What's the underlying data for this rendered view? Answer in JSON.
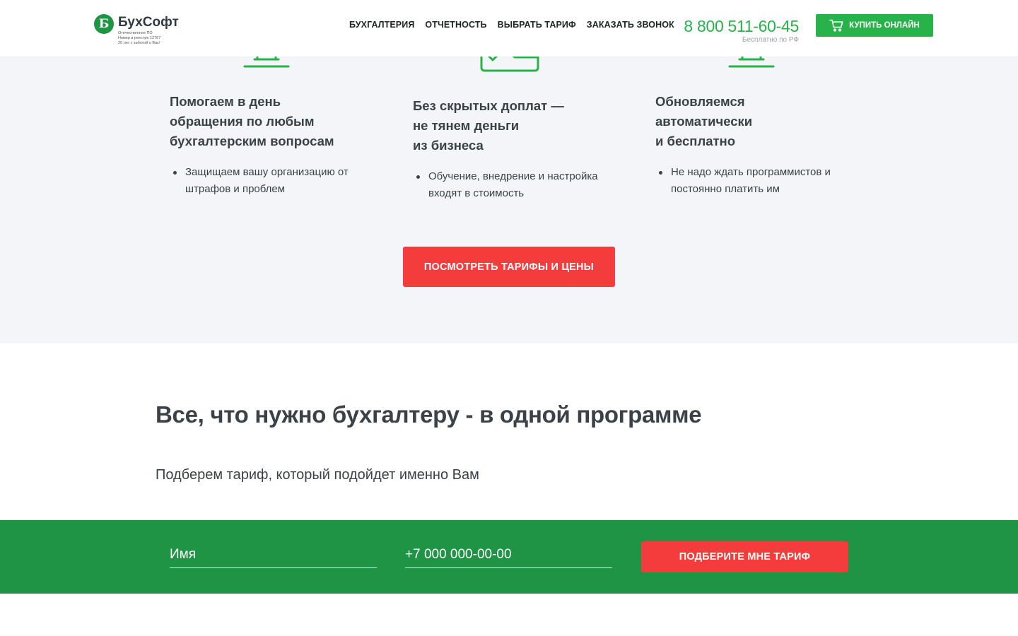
{
  "header": {
    "logo_letter": "Б",
    "logo_name": "БухСофт",
    "logo_sub": [
      "Отечественное ПО",
      "Номер в реестре 12767",
      "20 лет с заботой о Вас!"
    ],
    "nav": [
      "БУХГАЛТЕРИЯ",
      "ОТЧЕТНОСТЬ",
      "ВЫБРАТЬ ТАРИФ",
      "ЗАКАЗАТЬ ЗВОНОК"
    ],
    "phone": "8 800 511-60-45",
    "phone_note": "Бесплатно по РФ",
    "buy_label": "КУПИТЬ ОНЛАЙН",
    "buy_icon": "cart-icon"
  },
  "features": [
    {
      "icon": "support-icon",
      "title": "Помогаем в день\nобращения по любым\nбухгалтерским вопросам",
      "bullet": "Защищаем вашу организацию от штрафов и проблем"
    },
    {
      "icon": "wallet-icon",
      "title": "Без скрытых доплат —\nне тянем деньги\nиз бизнеса",
      "bullet": "Обучение, внедрение и настройка входят в стоимость"
    },
    {
      "icon": "update-icon",
      "title": "Обновляемся\nавтоматически\nи бесплатно",
      "bullet": "Не надо ждать программистов и постоянно платить им"
    }
  ],
  "cta_label": "ПОСМОТРЕТЬ ТАРИФЫ И ЦЕНЫ",
  "main": {
    "title": "Все, что нужно бухгалтеру - в одной программе",
    "subtitle": "Подберем тариф, который подойдет именно Вам"
  },
  "form": {
    "name_placeholder": "Имя",
    "phone_placeholder": "+7 000 000-00-00",
    "submit_label": "ПОДБЕРИТЕ МНЕ ТАРИФ"
  },
  "colors": {
    "brand_green": "#1e9444",
    "accent_green": "#27b24a",
    "cta_red": "#f53c3c",
    "band_bg": "#f4f5f8"
  }
}
